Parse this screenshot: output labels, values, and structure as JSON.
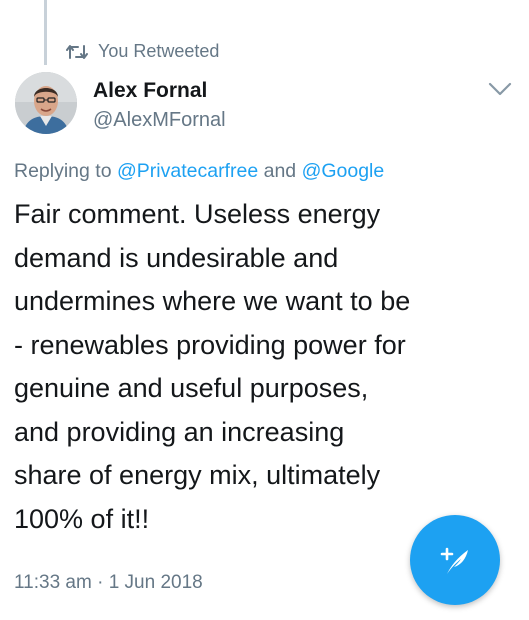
{
  "retweet": {
    "label": "You Retweeted",
    "icon": "retweet-icon"
  },
  "author": {
    "display_name": "Alex Fornal",
    "handle": "@AlexMFornal",
    "avatar": "profile-photo"
  },
  "reply": {
    "prefix": "Replying to",
    "mention_1": "@Privatecarfree",
    "conjunction": "and",
    "mention_2": "@Google"
  },
  "tweet": {
    "text": "Fair comment. Useless energy\ndemand is undesirable and\nundermines where we want to be\n- renewables providing power for\ngenuine and useful purposes,\nand providing an increasing\nshare of energy mix, ultimately\n100% of it!!",
    "timestamp": "11:33 am · 1 Jun 2018"
  },
  "compose_button": {
    "icon": "compose-tweet-icon"
  },
  "colors": {
    "accent": "#1da1f2",
    "secondary_text": "#657786",
    "primary_text": "#14171a"
  }
}
